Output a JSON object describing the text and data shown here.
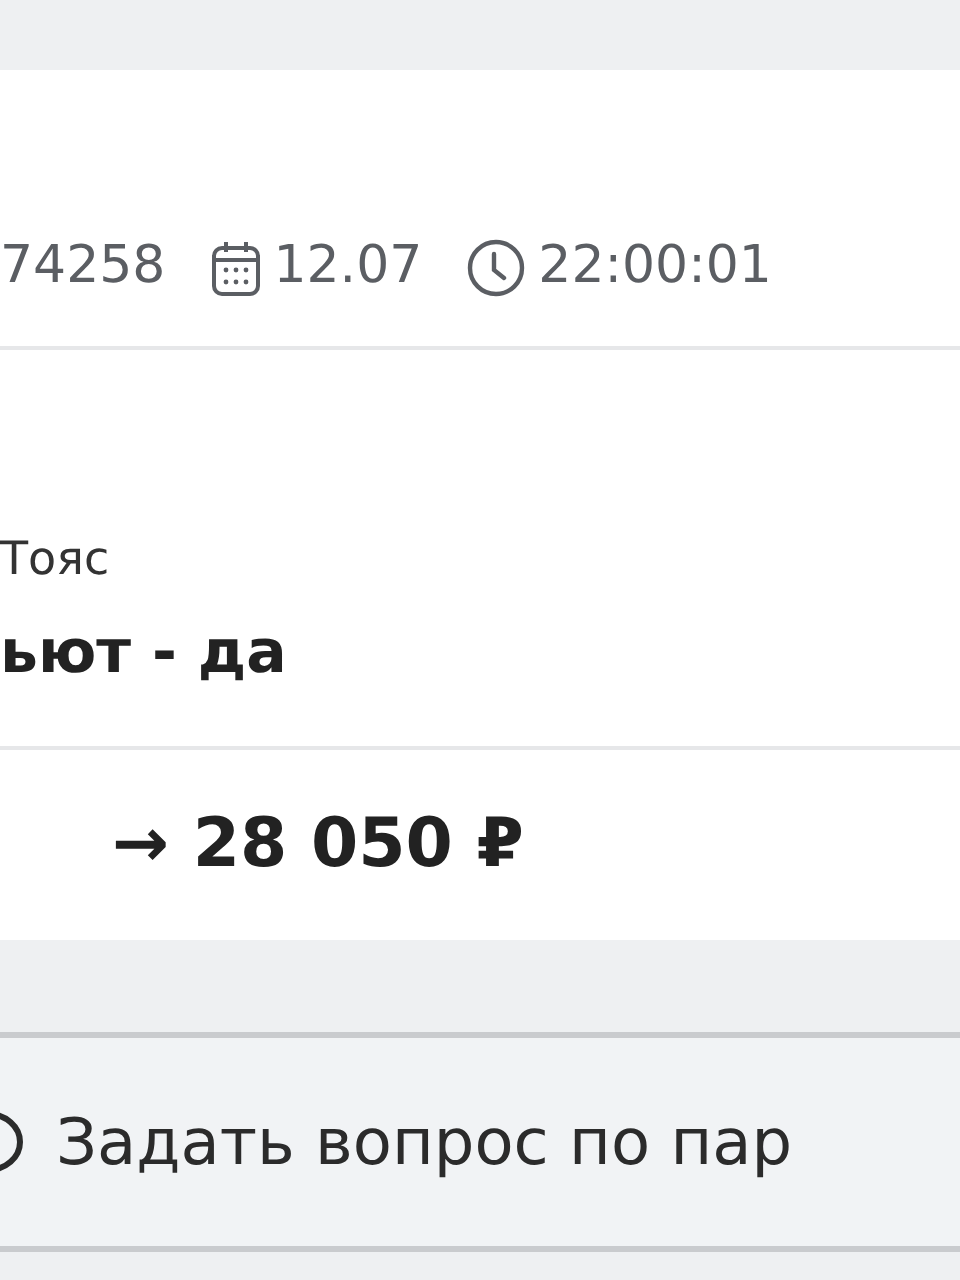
{
  "order": {
    "number": "74258",
    "date": "12.07",
    "time": "22:00:01"
  },
  "details": {
    "label": "Тояс",
    "value": "ьют - да"
  },
  "price": {
    "amount": "→ 28 050 ₽"
  },
  "ask_button": {
    "label": "Задать вопрос по пар"
  }
}
